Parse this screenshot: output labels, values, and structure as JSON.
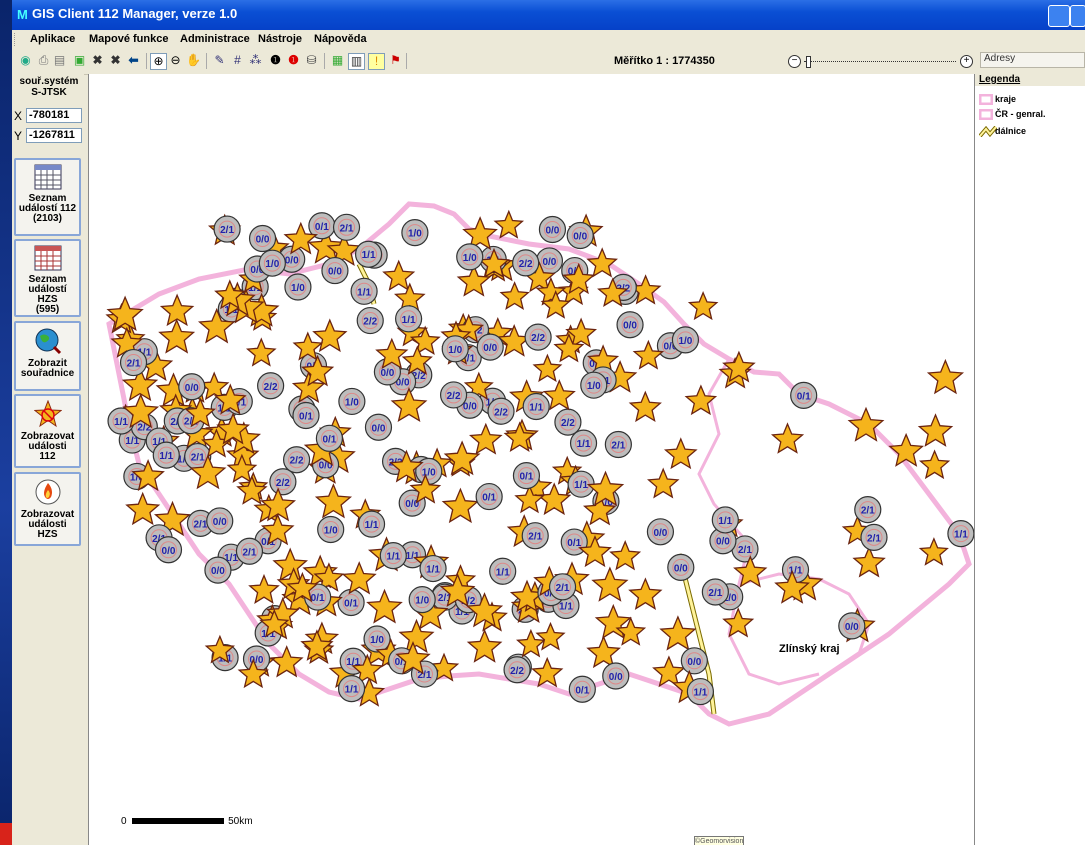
{
  "window": {
    "title": "GIS Client 112 Manager, verze 1.0"
  },
  "menu": [
    "Aplikace",
    "Mapové funkce",
    "Administrace",
    "Nástroje",
    "Nápověda"
  ],
  "toolbar": {
    "scale_label": "Měřítko  1 : 1774350",
    "search_placeholder": "Adresy",
    "icons": [
      "globe-icon",
      "print-icon",
      "copy-icon",
      "export-icon",
      "zoom-full-icon",
      "zoom-extent-icon",
      "back-icon",
      "zoom-in-icon",
      "zoom-out-icon",
      "pan-icon",
      "measure-icon",
      "grid-icon",
      "info-icon",
      "info-red-icon",
      "layers-icon",
      "table-icon",
      "panel-icon",
      "alert-icon",
      "flag-icon"
    ]
  },
  "coords": {
    "system_label": "souř.systém\nS-JTSK",
    "x_label": "X",
    "x_value": "-780181",
    "y_label": "Y",
    "y_value": "-1267811"
  },
  "sidebar": [
    {
      "name": "seznam-udalosti-112-button",
      "label": "Seznam\nudálostí 112\n(2103)",
      "icon": "calendar-icon"
    },
    {
      "name": "seznam-udalosti-hzs-button",
      "label": "Seznam\nudálostí\nHZS\n(595)",
      "icon": "calendar-red-icon"
    },
    {
      "name": "zobrazit-souradnice-button",
      "label": "Zobrazit\nsouřadnice",
      "icon": "globe-search-icon"
    },
    {
      "name": "zobrazovat-udalosti-112-button",
      "label": "Zobrazovat\nudálosti\n112",
      "icon": "star-no-icon"
    },
    {
      "name": "zobrazovat-udalosti-hzs-button",
      "label": "Zobrazovat\nudálosti\nHZS",
      "icon": "fire-icon"
    }
  ],
  "legend": {
    "title": "Legenda",
    "items": [
      {
        "label": "kraje",
        "icon": "region-pink-icon"
      },
      {
        "label": "ČR - genral.",
        "icon": "country-pink-icon"
      },
      {
        "label": "dálnice",
        "icon": "highway-yellow-icon"
      }
    ]
  },
  "map": {
    "region_label": "Zlínský kraj",
    "scalebar_start": "0",
    "scalebar_end": "50km",
    "copyright": "©Geomorvision",
    "marker_labels": [
      "1/1",
      "0/0",
      "2/1",
      "1/0",
      "2/2",
      "0/1",
      "1/1",
      "0/0"
    ]
  },
  "colors": {
    "title_bar": "#0a4fd4",
    "region_border": "#f3b3dc",
    "star_fill": "#f5b41c",
    "star_stroke": "#6b2410",
    "marker_fill": "#bdbdbd",
    "marker_text": "#2222aa",
    "highway": "#fff39a"
  }
}
